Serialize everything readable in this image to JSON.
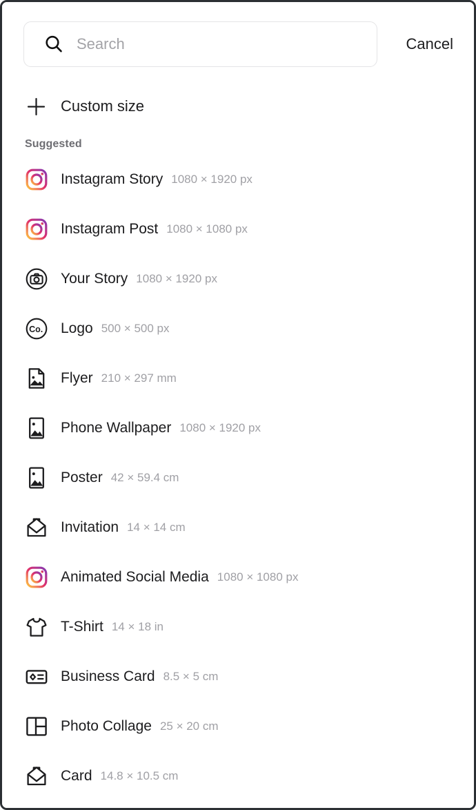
{
  "search": {
    "placeholder": "Search",
    "value": "",
    "icon": "search-icon",
    "cancel_label": "Cancel"
  },
  "custom_size": {
    "label": "Custom size",
    "icon": "plus-icon"
  },
  "section": {
    "title": "Suggested"
  },
  "colors": {
    "text_primary": "#1c1c1e",
    "text_secondary": "#a0a0a5",
    "section_header": "#6e6e73",
    "border": "#e4e4e6",
    "frame": "#2b2f33",
    "instagram_gradient_start": "#ffc93f",
    "instagram_gradient_mid": "#e1306c",
    "instagram_gradient_end": "#833ab4"
  },
  "items": [
    {
      "label": "Instagram Story",
      "dimensions": "1080 × 1920 px",
      "icon": "instagram-icon"
    },
    {
      "label": "Instagram Post",
      "dimensions": "1080 × 1080 px",
      "icon": "instagram-icon"
    },
    {
      "label": "Your Story",
      "dimensions": "1080 × 1920 px",
      "icon": "camera-circle-icon"
    },
    {
      "label": "Logo",
      "dimensions": "500 × 500 px",
      "icon": "logo-co-icon"
    },
    {
      "label": "Flyer",
      "dimensions": "210 × 297 mm",
      "icon": "document-image-icon"
    },
    {
      "label": "Phone Wallpaper",
      "dimensions": "1080 × 1920 px",
      "icon": "image-frame-icon"
    },
    {
      "label": "Poster",
      "dimensions": "42 × 59.4 cm",
      "icon": "image-frame-icon"
    },
    {
      "label": "Invitation",
      "dimensions": "14 × 14 cm",
      "icon": "envelope-icon"
    },
    {
      "label": "Animated Social Media",
      "dimensions": "1080 × 1080 px",
      "icon": "instagram-icon"
    },
    {
      "label": "T-Shirt",
      "dimensions": "14 × 18 in",
      "icon": "tshirt-icon"
    },
    {
      "label": "Business Card",
      "dimensions": "8.5 × 5 cm",
      "icon": "business-card-icon"
    },
    {
      "label": "Photo Collage",
      "dimensions": "25 × 20 cm",
      "icon": "collage-grid-icon"
    },
    {
      "label": "Card",
      "dimensions": "14.8 × 10.5 cm",
      "icon": "envelope-icon"
    }
  ]
}
